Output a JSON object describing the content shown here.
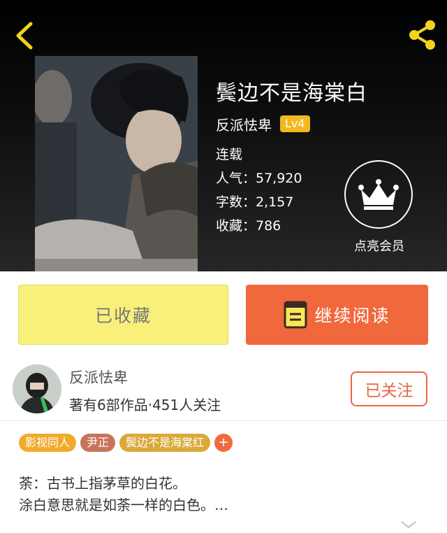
{
  "header": {
    "back_icon": "chevron-left-icon",
    "share_icon": "share-icon",
    "accent_color": "#f2d31c"
  },
  "book": {
    "title": "鬓边不是海棠白",
    "author": "反派怯卑",
    "level": "Lv4",
    "status": "连载",
    "popularity": "人气：57,920",
    "word_count": "字数：2,157",
    "favorites": "收藏：786"
  },
  "vip": {
    "label": "点亮会员",
    "icon": "crown-icon"
  },
  "actions": {
    "favorited_label": "已收藏",
    "continue_label": "继续阅读",
    "book_icon": "book-icon",
    "favorited_color": "#f9f07c",
    "continue_color": "#f0683b"
  },
  "author_card": {
    "name": "反派怯卑",
    "works": "著有6部作品·451人关注",
    "follow_label": "已关注"
  },
  "tags": [
    {
      "label": "影视同人",
      "color": "#f2aa2c"
    },
    {
      "label": "尹正",
      "color": "#c8745c"
    },
    {
      "label": "鬓边不是海棠红",
      "color": "#d9a93a"
    },
    {
      "label": "+",
      "color": "#ee6b3e"
    }
  ],
  "description": {
    "line1": "荼：古书上指茅草的白花。",
    "line2": "涂白意思就是如荼一样的白色。…",
    "expand_icon": "chevron-down-icon"
  }
}
